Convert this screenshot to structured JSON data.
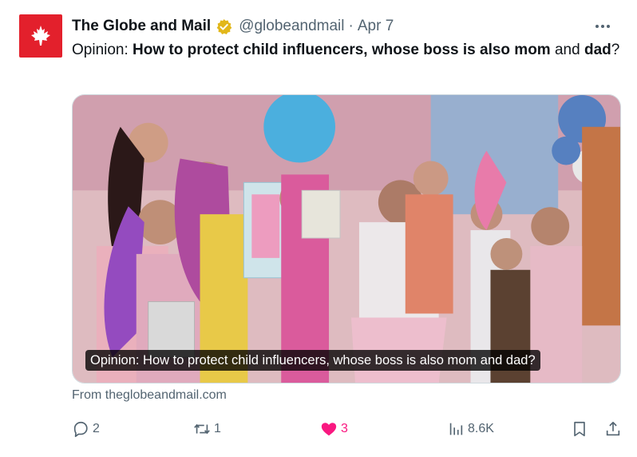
{
  "tweet": {
    "author_name": "The Globe and Mail",
    "handle": "@globeandmail",
    "separator": "·",
    "date": "Apr 7",
    "text_prefix": "Opinion: ",
    "text_bold_1": "How to protect child influencers, whose boss is also mom",
    "text_middle": " and ",
    "text_bold_2": "dad",
    "text_suffix": "?"
  },
  "media": {
    "caption": "Opinion: How to protect child influencers, whose boss is also mom and dad?"
  },
  "source": {
    "text": "From theglobeandmail.com"
  },
  "actions": {
    "replies": "2",
    "reposts": "1",
    "likes": "3",
    "views": "8.6K"
  },
  "colors": {
    "brand": "#e3202c",
    "verified_badge": "#e2b719",
    "like_active": "#f91880",
    "secondary_text": "#536471"
  },
  "icons": {
    "avatar": "maple-leaf-icon",
    "verified": "verified-badge-icon",
    "more": "more-icon",
    "reply": "reply-icon",
    "repost": "repost-icon",
    "like": "heart-icon",
    "views": "views-icon",
    "bookmark": "bookmark-icon",
    "share": "share-icon"
  }
}
